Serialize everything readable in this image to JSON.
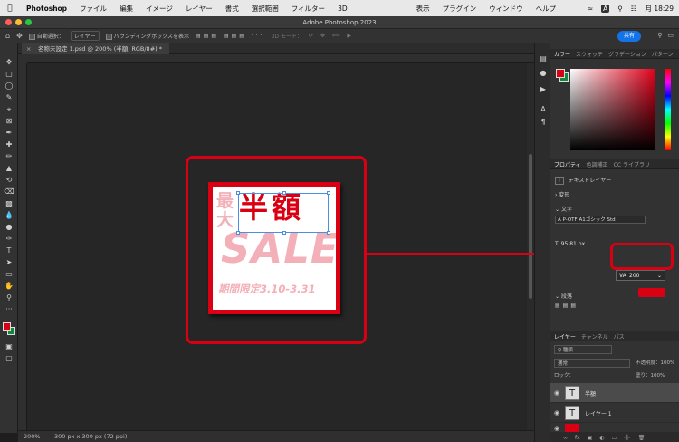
{
  "menubar": {
    "app": "Photoshop",
    "items": [
      "ファイル",
      "編集",
      "イメージ",
      "レイヤー",
      "書式",
      "選択範囲",
      "フィルター",
      "3D"
    ],
    "right_items": [
      "表示",
      "プラグイン",
      "ウィンドウ",
      "ヘルプ"
    ],
    "date": "月 18:29"
  },
  "window": {
    "title": "Adobe Photoshop 2023"
  },
  "options": {
    "auto_select": "自動選択：",
    "layer_select": "レイヤー",
    "bounding": "バウンディングボックスを表示",
    "mode_3d": "3D モード：",
    "share": "共有"
  },
  "document": {
    "tab": "名称未設定 1.psd @ 200% (半額, RGB/8#) *",
    "zoom": "200%",
    "dims": "300 px x 300 px (72 ppi)"
  },
  "artwork": {
    "tag": "最大",
    "main": "半額",
    "sale": "SALE",
    "period": "期間限定3.10-3.31"
  },
  "color_panel": {
    "tabs": [
      "カラー",
      "スウォッチ",
      "グラデーション",
      "パターン"
    ],
    "fg": "#d80012",
    "bg": "#0e8a3e"
  },
  "properties": {
    "tabs": [
      "プロパティ",
      "色調補正",
      "CC ライブラリ"
    ],
    "layer_type": "テキストレイヤー",
    "transform": "変形",
    "text_section": "文字",
    "font": "A P-OTF A1ゴシック Std",
    "size": "95.81 px",
    "tracking": "200",
    "paragraph": "段落"
  },
  "layers_panel": {
    "tabs": [
      "レイヤー",
      "チャンネル",
      "パス"
    ],
    "filter": "種類",
    "blend": "通常",
    "opacity": "不透明度：100%",
    "lock": "ロック：",
    "fill": "塗り：100%",
    "layers": [
      {
        "name": "半額",
        "thumb": "T",
        "selected": true
      },
      {
        "name": "レイヤー 1",
        "thumb": "T",
        "selected": false
      }
    ]
  },
  "colors": {
    "accent": "#d80012",
    "share": "#1473e6"
  }
}
